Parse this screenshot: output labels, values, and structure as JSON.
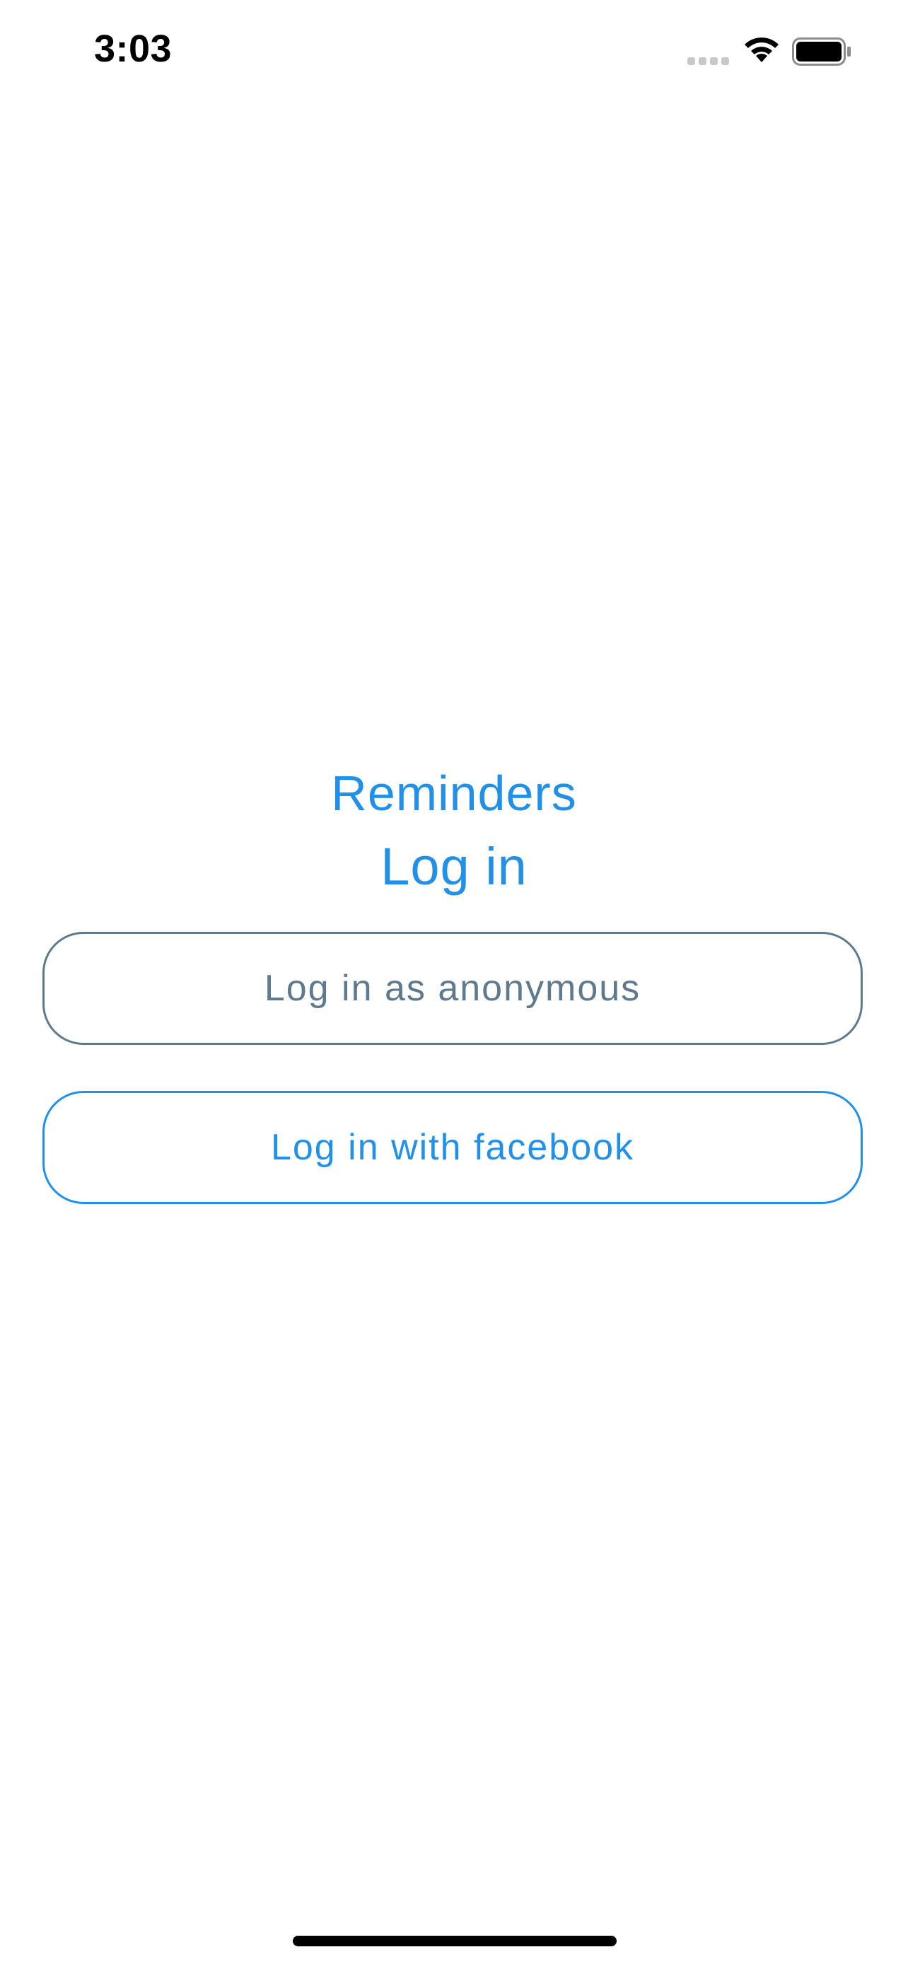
{
  "status_bar": {
    "time": "3:03",
    "signal_icon": "cellular-signal-icon",
    "wifi_icon": "wifi-icon",
    "battery_icon": "battery-icon"
  },
  "header": {
    "app_title": "Reminders",
    "screen_title": "Log in"
  },
  "buttons": {
    "anonymous_label": "Log in as anonymous",
    "facebook_label": "Log in with facebook"
  },
  "colors": {
    "accent": "#2390e8",
    "muted": "#5f7a8d",
    "background": "#ffffff"
  }
}
